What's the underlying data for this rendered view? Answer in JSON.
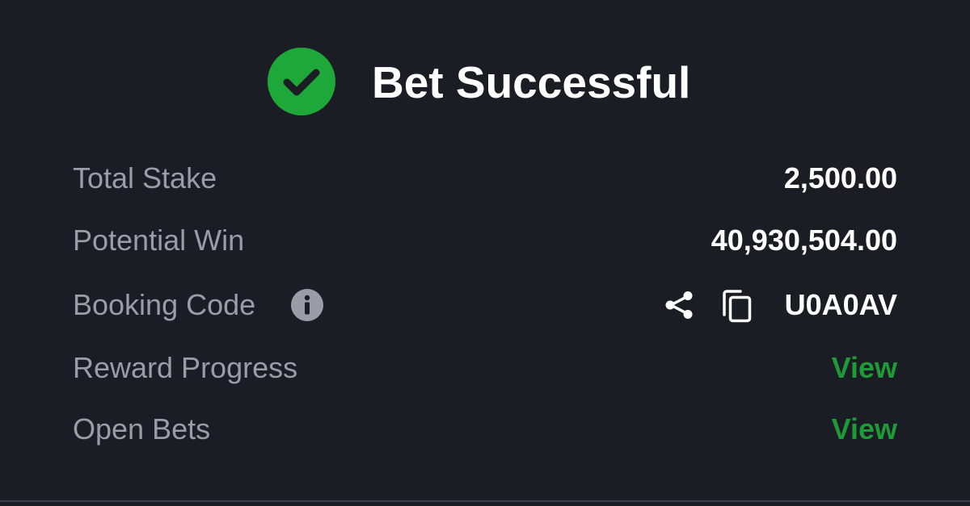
{
  "header": {
    "title": "Bet Successful",
    "icon": "check-circle-icon",
    "icon_color": "#1fa83a"
  },
  "summary": {
    "total_stake": {
      "label": "Total Stake",
      "value": "2,500.00"
    },
    "potential_win": {
      "label": "Potential Win",
      "value": "40,930,504.00"
    },
    "booking_code": {
      "label": "Booking Code",
      "value": "U0A0AV",
      "info_icon": "info-icon",
      "share_icon": "share-icon",
      "copy_icon": "copy-icon"
    },
    "reward_progress": {
      "label": "Reward Progress",
      "link": "View"
    },
    "open_bets": {
      "label": "Open Bets",
      "link": "View"
    }
  },
  "colors": {
    "background": "#1b1d24",
    "label": "#9a9ca7",
    "value": "#ffffff",
    "link": "#1e9a38"
  }
}
